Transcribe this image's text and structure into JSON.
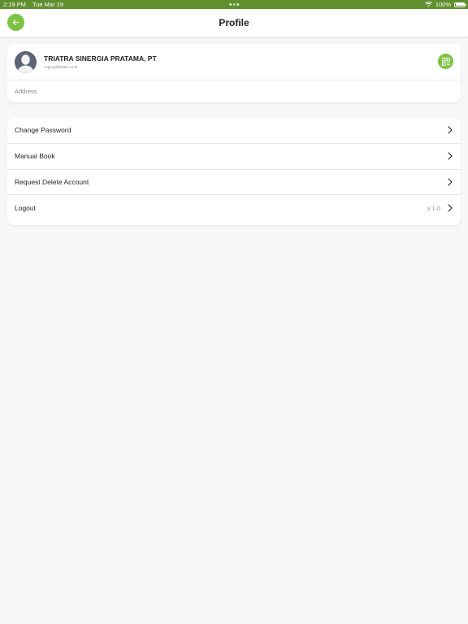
{
  "status_bar": {
    "time": "2:19 PM",
    "date": "Tue Mar 19",
    "battery": "100%"
  },
  "header": {
    "title": "Profile",
    "back_icon": "arrow-left-icon"
  },
  "profile": {
    "name": "TRIATRA SINERGIA PRATAMA, PT",
    "email": "copy.tjr@triatra.co.id",
    "address_label": "Address",
    "qr_icon": "qr-code-icon"
  },
  "menu": {
    "items": [
      {
        "label": "Change Password"
      },
      {
        "label": "Manual Book"
      },
      {
        "label": "Request Delete Account"
      },
      {
        "label": "Logout",
        "version": "v 1.0"
      }
    ]
  },
  "colors": {
    "status_bar": "#5f8f2e",
    "accent": "#7cc243",
    "background": "#f7f7f7"
  }
}
